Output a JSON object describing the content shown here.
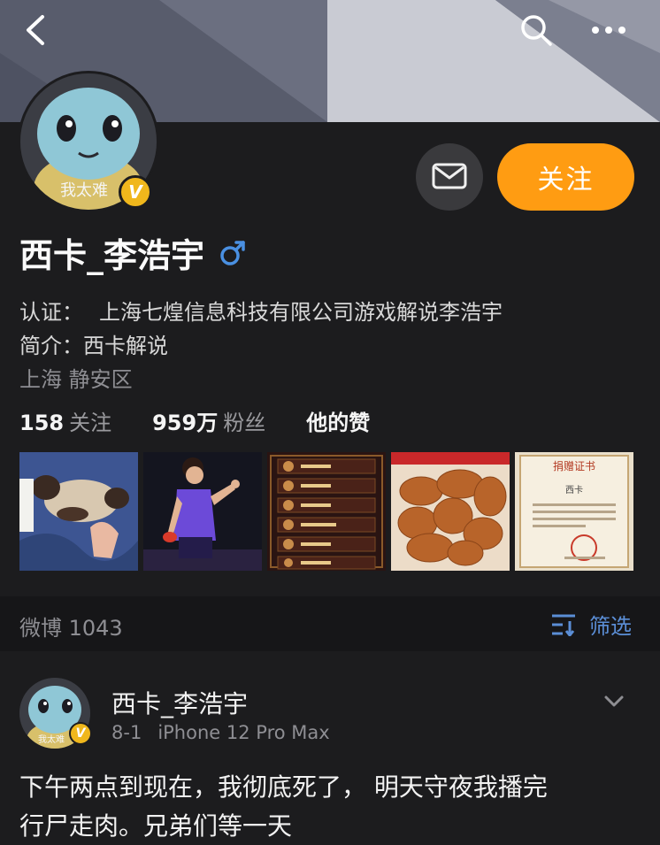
{
  "profile": {
    "name": "西卡_李浩宇",
    "avatar_caption": "我太难",
    "verified_mark": "V",
    "follow_label": "关注",
    "certification_label": "认证：",
    "certification": "上海七煌信息科技有限公司游戏解说李浩宇",
    "bio_label": "简介：",
    "bio": "西卡解说",
    "location": "上海 静安区",
    "stats": {
      "following_count": "158",
      "following_label": "关注",
      "followers_count": "959万",
      "followers_label": "粉丝",
      "likes_label": "他的赞"
    }
  },
  "photos": {
    "certificate_title": "捐赠证书",
    "certificate_name": "西卡"
  },
  "feed": {
    "weibo_count_label": "微博 1043",
    "filter_label": "筛选"
  },
  "post": {
    "author": "西卡_李浩宇",
    "date": "8-1",
    "device": "iPhone 12 Pro Max",
    "text_line1": "下午两点到现在，我彻底死了， 明天守夜我播完",
    "text_line2": "行尸走肉。兄弟们等一天"
  },
  "colors": {
    "accent": "#ff9c12",
    "verified": "#f0b71c",
    "link_blue": "#5b8ed6",
    "gender_blue": "#4a90e2",
    "background": "#1c1c1e"
  }
}
